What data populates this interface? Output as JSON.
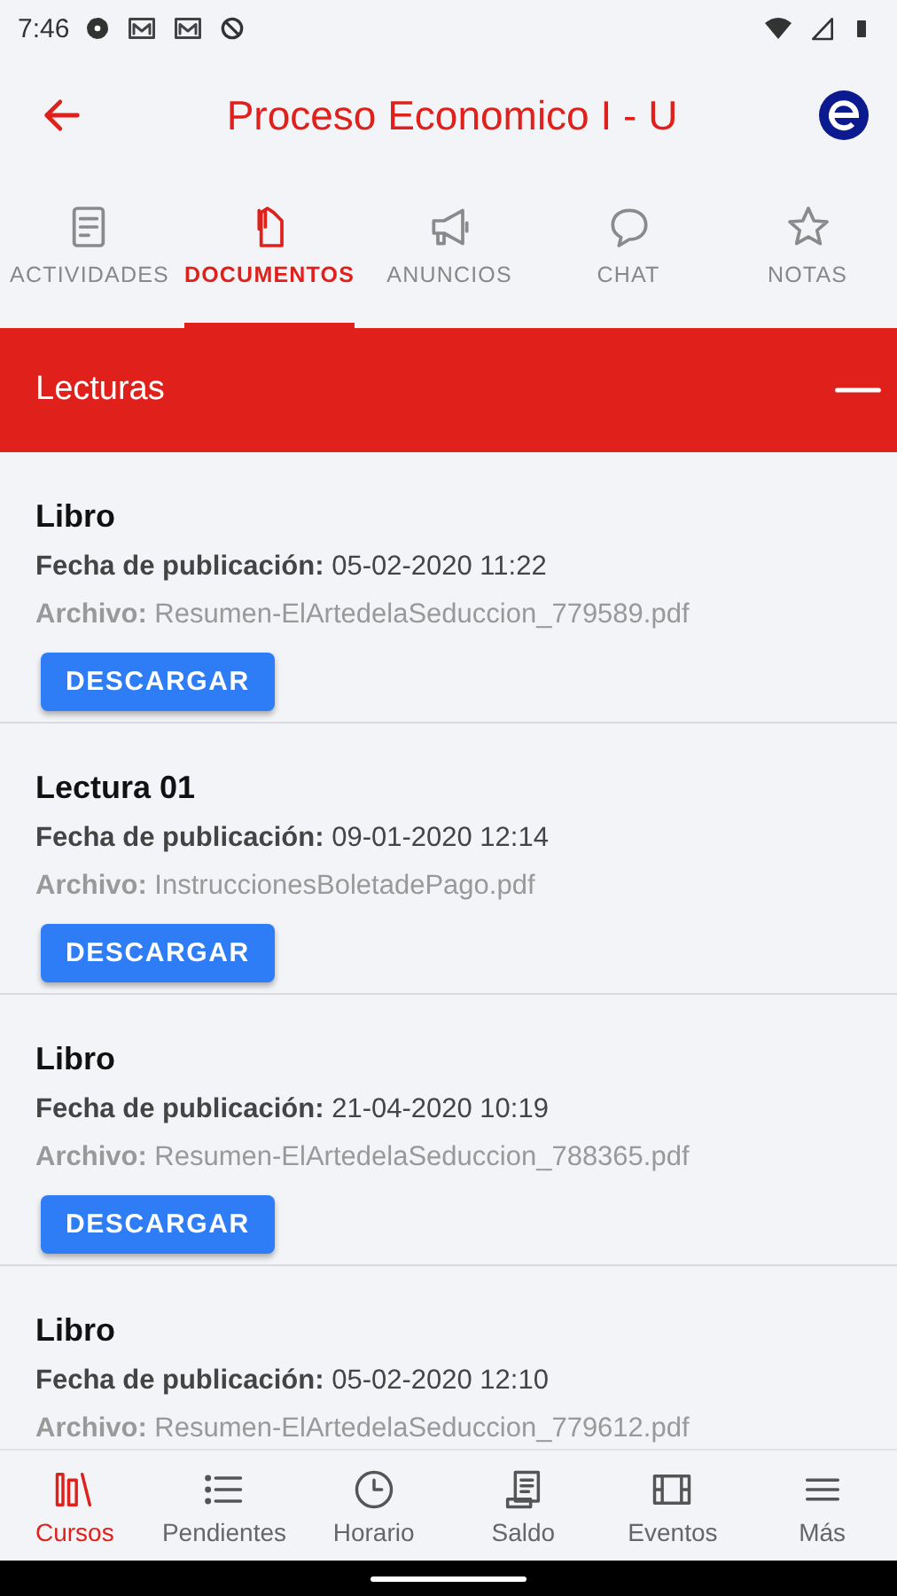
{
  "status_bar": {
    "time": "7:46"
  },
  "header": {
    "title": "Proceso Economico I - U"
  },
  "tabs": [
    {
      "label": "ACTIVIDADES",
      "selected": false
    },
    {
      "label": "DOCUMENTOS",
      "selected": true
    },
    {
      "label": "ANUNCIOS",
      "selected": false
    },
    {
      "label": "CHAT",
      "selected": false
    },
    {
      "label": "NOTAS",
      "selected": false
    }
  ],
  "section": {
    "title": "Lecturas",
    "expanded": true
  },
  "documents": [
    {
      "title": "Libro",
      "date": "**Fecha de publicación:** 05-02-2020 11:22",
      "file": "**Archivo:** Resumen-ElArtedelaSeduccion_779589.pdf",
      "button": "DESCARGAR"
    },
    {
      "title": "Lectura 01",
      "date": "**Fecha de publicación:** 09-01-2020 12:14",
      "file": "**Archivo:** InstruccionesBoletadePago.pdf",
      "button": "DESCARGAR"
    },
    {
      "title": "Libro",
      "date": "**Fecha de publicación:** 21-04-2020 10:19",
      "file": "**Archivo:** Resumen-ElArtedelaSeduccion_788365.pdf",
      "button": "DESCARGAR"
    },
    {
      "title": "Libro",
      "date": "**Fecha de publicación:** 05-02-2020 12:10",
      "file": "**Archivo:** Resumen-ElArtedelaSeduccion_779612.pdf"
    }
  ],
  "bottom_nav": [
    {
      "label": "Cursos",
      "selected": true
    },
    {
      "label": "Pendientes",
      "selected": false
    },
    {
      "label": "Horario",
      "selected": false
    },
    {
      "label": "Saldo",
      "selected": false
    },
    {
      "label": "Eventos",
      "selected": false
    },
    {
      "label": "Más",
      "selected": false
    }
  ]
}
